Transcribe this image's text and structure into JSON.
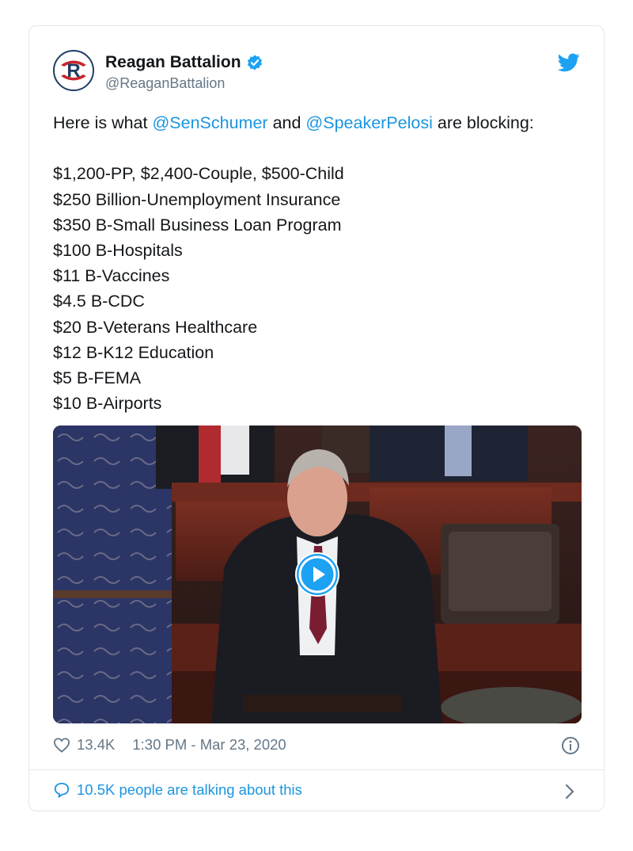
{
  "account": {
    "name": "Reagan Battalion",
    "handle": "@ReaganBattalion",
    "verified_icon": "verified-badge-icon",
    "avatar_letter": "R",
    "brand_color": "#c8262c"
  },
  "tweet": {
    "intro_prefix": "Here is what ",
    "mention_1": "@SenSchumer",
    "intro_middle": " and ",
    "mention_2": "@SpeakerPelosi",
    "intro_suffix": " are blocking:",
    "items": [
      "$1,200-PP, $2,400-Couple, $500-Child",
      "$250 Billion-Unemployment Insurance",
      "$350 B-Small Business Loan Program",
      "$100 B-Hospitals",
      "$11 B-Vaccines",
      "$4.5 B-CDC",
      "$20 B-Veterans Healthcare",
      "$12 B-K12 Education",
      "$5 B-FEMA",
      "$10 B-Airports"
    ]
  },
  "media": {
    "type": "video",
    "play_icon": "play-icon"
  },
  "footer": {
    "likes": "13.4K",
    "timestamp": "1:30 PM - Mar 23, 2020",
    "talking": "10.5K people are talking about this"
  },
  "colors": {
    "link": "#1b95e0",
    "secondary_text": "#657786",
    "twitter_blue": "#1da1f2"
  }
}
